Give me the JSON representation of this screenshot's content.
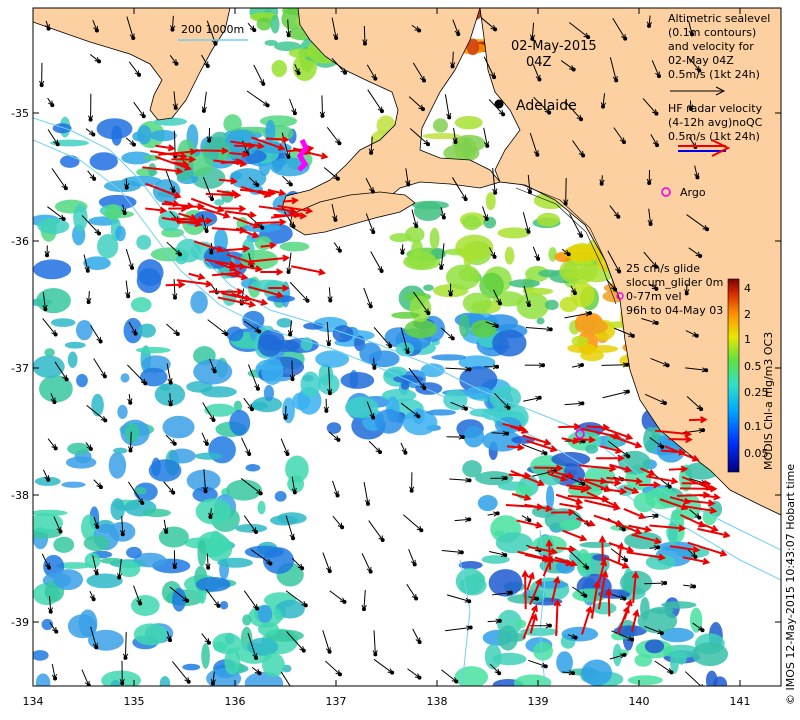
{
  "map": {
    "date_line": "02-May-2015",
    "time_line": "04Z",
    "city": "Adelaide",
    "scale_text": "200  1000m",
    "legend": {
      "sealevel_lines": [
        "Altimetric sealevel",
        "(0.1m contours)",
        "and velocity for",
        "02-May 04Z",
        "0.5m/s (1kt 24h)"
      ],
      "hf_lines": [
        "HF radar velocity",
        "(4-12h avg)noQC",
        "0.5m/s (1kt 24h)"
      ],
      "argo_label": "Argo",
      "glider_lines": [
        "25 cm/s glide",
        "slocum_glider 0m",
        "0-77m vel",
        "96h to 04-May 03"
      ]
    },
    "colorbar": {
      "title": "MODIS Chl-a mg/m3 OC3",
      "ticks": [
        "4",
        "2",
        "1",
        "0.5",
        "0.25",
        "0.1",
        "0.05"
      ]
    },
    "credit": "© IMOS 12-May-2015 10:43:07 Hobart time",
    "x_ticks": [
      "134",
      "135",
      "136",
      "137",
      "138",
      "139",
      "140",
      "141"
    ],
    "y_ticks": [
      "-35",
      "-36",
      "-37",
      "-38",
      "-39"
    ],
    "colors": {
      "land": "#fcd0a0",
      "chl_low": "#1e4ecf",
      "chl_mid": "#3fc8c0",
      "chl_high": "#c04a10",
      "hf_vector": "#ee0000",
      "argo": "#ee00ee",
      "glider": "#ff00ff"
    }
  }
}
